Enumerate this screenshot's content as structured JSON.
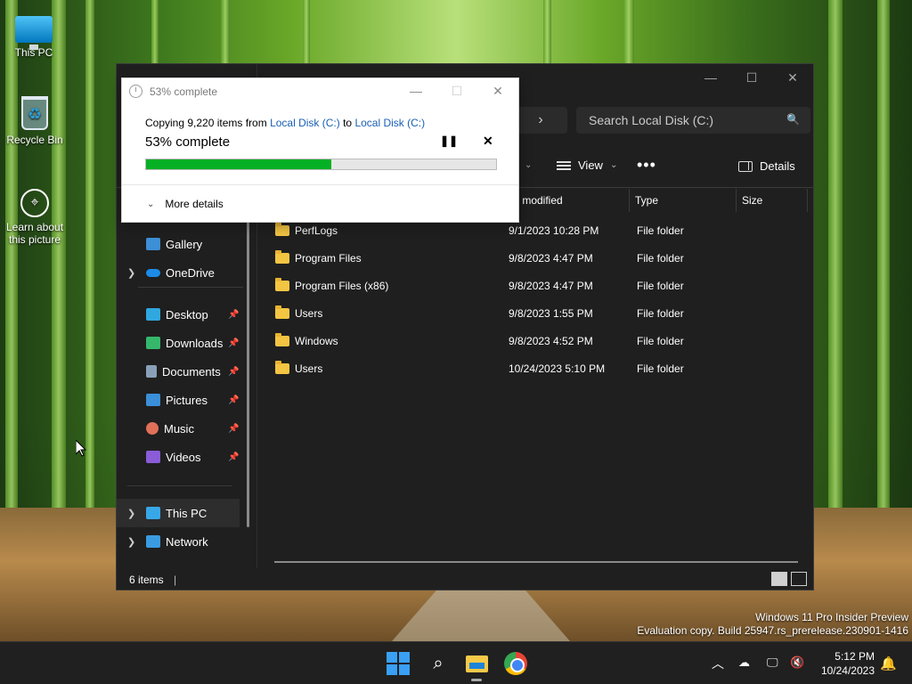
{
  "desktop": {
    "icons": [
      {
        "label": "This PC"
      },
      {
        "label": "Recycle Bin"
      },
      {
        "label": "Learn about this picture"
      }
    ],
    "watermark": {
      "line1": "Windows 11 Pro Insider Preview",
      "line2": "Evaluation copy. Build 25947.rs_prerelease.230901-1416"
    }
  },
  "explorer": {
    "search_placeholder": "Search Local Disk (C:)",
    "toolbar": {
      "view_label": "View",
      "more_label": "•••",
      "details_label": "Details"
    },
    "columns": {
      "date": "te modified",
      "type": "Type",
      "size": "Size"
    },
    "nav": [
      {
        "label": "Gallery",
        "icon": "gallery-icon",
        "color": "#3d8fd6"
      },
      {
        "label": "OneDrive",
        "icon": "onedrive-icon",
        "color": "#1c8be8"
      },
      {
        "label": "Desktop",
        "icon": "desktop-icon",
        "color": "#2fa8e0"
      },
      {
        "label": "Downloads",
        "icon": "download-icon",
        "color": "#35b86b"
      },
      {
        "label": "Documents",
        "icon": "document-icon",
        "color": "#8aa0b8"
      },
      {
        "label": "Pictures",
        "icon": "pictures-icon",
        "color": "#3a8fd8"
      },
      {
        "label": "Music",
        "icon": "music-icon",
        "color": "#e0705a"
      },
      {
        "label": "Videos",
        "icon": "videos-icon",
        "color": "#8a5cd8"
      },
      {
        "label": "This PC",
        "icon": "this-pc-icon",
        "color": "#38a7e8"
      },
      {
        "label": "Network",
        "icon": "network-icon",
        "color": "#3b9be0"
      }
    ],
    "files": [
      {
        "name": "PerfLogs",
        "date": "9/1/2023 10:28 PM",
        "type": "File folder"
      },
      {
        "name": "Program Files",
        "date": "9/8/2023 4:47 PM",
        "type": "File folder"
      },
      {
        "name": "Program Files (x86)",
        "date": "9/8/2023 4:47 PM",
        "type": "File folder"
      },
      {
        "name": "Users",
        "date": "9/8/2023 1:55 PM",
        "type": "File folder"
      },
      {
        "name": "Windows",
        "date": "9/8/2023 4:52 PM",
        "type": "File folder"
      },
      {
        "name": "Users",
        "date": "10/24/2023 5:10 PM",
        "type": "File folder"
      }
    ],
    "status": "6 items"
  },
  "copy_dialog": {
    "title": "53% complete",
    "copy_prefix": "Copying 9,220 items from ",
    "source": "Local Disk (C:)",
    "to_word": " to ",
    "destination": "Local Disk (C:)",
    "percent_text": "53% complete",
    "progress": 0.53,
    "more_details": "More details",
    "accent_color": "#06b025"
  },
  "taskbar": {
    "time": "5:12 PM",
    "date": "10/24/2023"
  }
}
